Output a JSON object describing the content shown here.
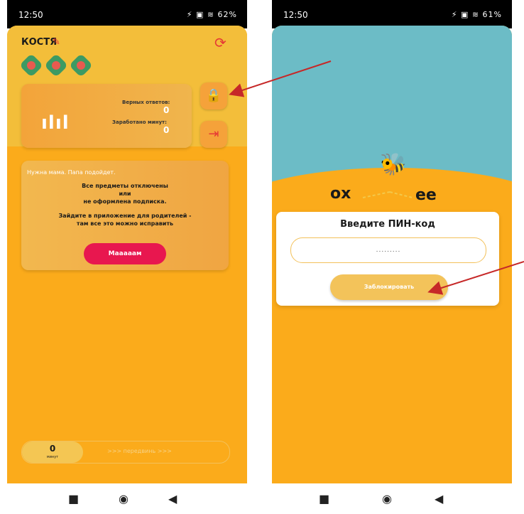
{
  "left": {
    "status": {
      "time": "12:50",
      "icons": "⚡ ▣ ≋ 62%"
    },
    "username": "КОСТЯ",
    "stats": {
      "correct_label": "Верных ответов:",
      "correct_value": "0",
      "earned_label": "Заработано минут:",
      "earned_value": "0"
    },
    "message": {
      "small_text": "Нужна мама. Папа подойдет.",
      "line1": "Все предметы отключены",
      "line2": "или",
      "line3": "не оформлена подписка.",
      "line4": "Зайдите в приложение для родителей -",
      "line5": "там все это можно исправить",
      "button_label": "Мааааам"
    },
    "slider": {
      "value": "0",
      "unit": "минут",
      "hint": ">>> передвинь >>>"
    }
  },
  "right": {
    "status": {
      "time": "12:50",
      "icons": "⚡ ▣ ≋ 61%"
    },
    "logo_left": "ox",
    "logo_right": "ee",
    "pin_title": "Введите ПИН-код",
    "pin_value": ".........",
    "lock_button": "Заблокировать"
  },
  "nav": {
    "square": "■",
    "circle": "◉",
    "back": "◀"
  },
  "colors": {
    "accent": "#fbab1b",
    "button_red": "#e8174f",
    "teal": "#6cbcc6",
    "arrow": "#c62828"
  }
}
